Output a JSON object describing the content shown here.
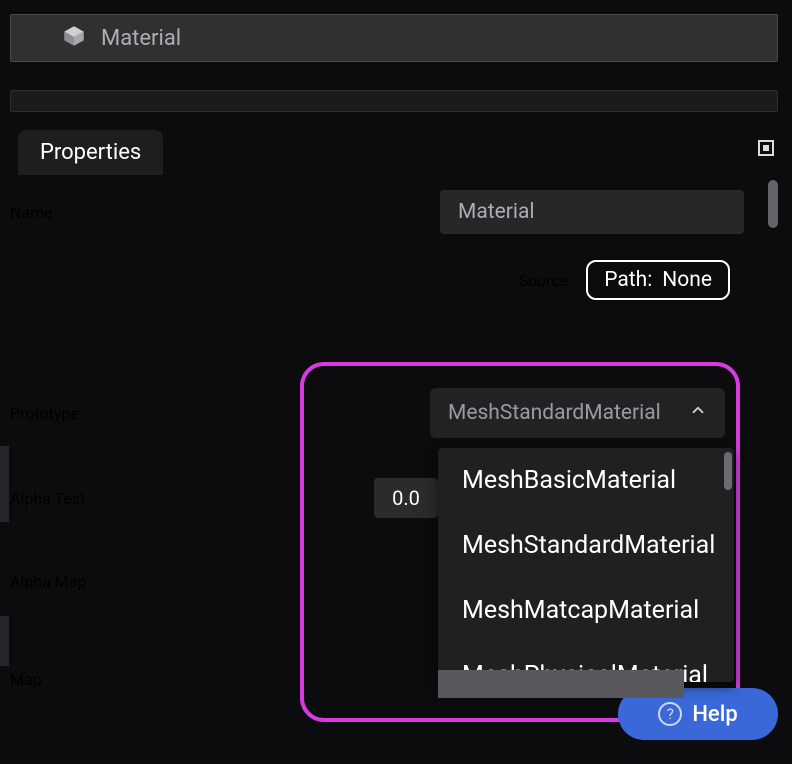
{
  "header": {
    "title": "Material",
    "icon": "material-icon"
  },
  "tabs": {
    "properties": "Properties"
  },
  "props": {
    "name": {
      "label": "Name",
      "value": "Material"
    },
    "source": {
      "label": "Source",
      "path_label": "Path:",
      "path_value": "None"
    },
    "prototype": {
      "label": "Prototype",
      "selected": "MeshStandardMaterial",
      "options": [
        "MeshBasicMaterial",
        "MeshStandardMaterial",
        "MeshMatcapMaterial",
        "MeshPhysicalMaterial"
      ]
    },
    "alpha_test": {
      "label": "Alpha Test",
      "value": "0.0"
    },
    "alpha_map": {
      "label": "Alpha Map"
    },
    "map": {
      "label": "Map"
    }
  },
  "help": {
    "label": "Help",
    "qmark": "?"
  }
}
